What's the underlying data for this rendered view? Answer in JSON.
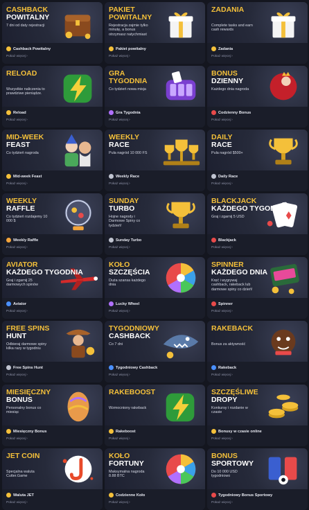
{
  "more_label": "Pokaż więcej",
  "more_chevron": "›",
  "cards": [
    {
      "title_yellow": "CASHBACK",
      "title_white": "POWITALNY",
      "title_single": "",
      "desc": "7 dni od daty rejestracji",
      "badge": "Cashback Powitalny",
      "badge_color": "#f4c03a",
      "art": "treasure-chest-icon"
    },
    {
      "title_yellow": "",
      "title_white": "",
      "title_single": "PAKIET\nPOWITALNY",
      "desc": "Rejestracja zajmie tylko minutę, a bonus otrzymasz natychmiast",
      "badge": "Pakiet powitalny",
      "badge_color": "#f4c03a",
      "art": "gift-box-icon"
    },
    {
      "title_yellow": "ZADANIA",
      "title_white": "",
      "title_single": "",
      "desc": "Complete tasks and earn cash rewards",
      "badge": "Zadania",
      "badge_color": "#f4c03a",
      "art": "gift-box-icon"
    },
    {
      "title_yellow": "RELOAD",
      "title_white": "",
      "title_single": "",
      "desc": "Wszystkie naliczenia to prawdziwe pieniądze.",
      "badge": "Reload",
      "badge_color": "#f4c03a",
      "art": "lightning-icon"
    },
    {
      "title_yellow": "",
      "title_white": "",
      "title_single": "GRA\nTYGODNIA",
      "desc": "Co tydzień nowa misja",
      "badge": "Gra Tygodnia",
      "badge_color": "#b070ff",
      "art": "slot-machine-icon"
    },
    {
      "title_yellow": "BONUS",
      "title_white": "DZIENNY",
      "title_single": "",
      "desc": "Każdego dnia nagroda",
      "badge": "Codzienny Bonus",
      "badge_color": "#e84a4a",
      "art": "queen-icon"
    },
    {
      "title_yellow": "MID-WEEK",
      "title_white": "FEAST",
      "title_single": "",
      "desc": "Co tydzień nagroda",
      "badge": "Mid-week Feast",
      "badge_color": "#f4c03a",
      "art": "characters-icon"
    },
    {
      "title_yellow": "WEEKLY",
      "title_white": "RACE",
      "title_single": "",
      "desc": "Pula nagród 10 000 FS",
      "badge": "Weekly Race",
      "badge_color": "#c0c4d0",
      "art": "trophies-icon"
    },
    {
      "title_yellow": "DAILY",
      "title_white": "RACE",
      "title_single": "",
      "desc": "Pula nagród $500+",
      "badge": "Daily Race",
      "badge_color": "#c0c4d0",
      "art": "trophy-icon"
    },
    {
      "title_yellow": "WEEKLY",
      "title_white": "RAFFLE",
      "title_single": "",
      "desc": "Co tydzień rozdajemy 10 000 $",
      "badge": "Weekly Raffle",
      "badge_color": "#f4a43a",
      "art": "lottery-ball-icon"
    },
    {
      "title_yellow": "SUNDAY",
      "title_white": "TURBO",
      "title_single": "",
      "desc": "Hojne nagrody i Darmowe Spiny co tydzień!",
      "badge": "Sunday Turbo",
      "badge_color": "#c0c4d0",
      "art": "trophy-icon"
    },
    {
      "title_yellow": "BLACKJACK",
      "title_white": "KAŻDEGO TYGODNIA",
      "title_single": "",
      "desc": "Graj i zgarnij 5 USD",
      "badge": "Blackjack",
      "badge_color": "#e84a4a",
      "art": "cards-icon"
    },
    {
      "title_yellow": "AVIATOR",
      "title_white": "KAŻDEGO TYGODNIA",
      "title_single": "",
      "desc": "Graj i zgarnij 25 darmowych spinów",
      "badge": "Aviator",
      "badge_color": "#4a90ff",
      "art": "plane-icon"
    },
    {
      "title_yellow": "KOŁO",
      "title_white": "SZCZĘŚCIA",
      "title_single": "",
      "desc": "Duża szansa każdego dnia",
      "badge": "Lucky Wheel",
      "badge_color": "#b070ff",
      "art": "wheel-icon"
    },
    {
      "title_yellow": "SPINNER",
      "title_white": "KAŻDEGO DNIA",
      "title_single": "",
      "desc": "Kręć i wygrywaj cashback, rakeback lub darmowe spiny co dzień!",
      "badge": "Spinner",
      "badge_color": "#e84a4a",
      "art": "spinner-icon"
    },
    {
      "title_yellow": "FREE SPINS",
      "title_white": "HUNT",
      "title_single": "",
      "desc": "Odbieraj darmowe spiny kilka razy w tygodniu",
      "badge": "Free Spins Hunt",
      "badge_color": "#c0c4d0",
      "art": "cowboy-icon"
    },
    {
      "title_yellow": "TYGODNIOWY",
      "title_white": "CASHBACK",
      "title_single": "",
      "desc": "Co 7 dni",
      "badge": "Tygodniowy Cashback",
      "badge_color": "#4a90ff",
      "art": "shark-icon"
    },
    {
      "title_yellow": "RAKEBACK",
      "title_white": "",
      "title_single": "",
      "desc": "Bonus za aktywność",
      "badge": "Rakeback",
      "badge_color": "#4a90ff",
      "art": "dog-icon"
    },
    {
      "title_yellow": "MIESIĘCZNY",
      "title_white": "BONUS",
      "title_single": "",
      "desc": "Personalny bonus co miesiąc",
      "badge": "Miesięczny Bonus",
      "badge_color": "#f4c03a",
      "art": "egg-icon"
    },
    {
      "title_yellow": "RAKEBOOST",
      "title_white": "",
      "title_single": "",
      "desc": "Wzmocniony rakeback",
      "badge": "Rakeboost",
      "badge_color": "#f4c03a",
      "art": "lightning-icon"
    },
    {
      "title_yellow": "SZCZĘŚLIWE",
      "title_white": "DROPY",
      "title_single": "",
      "desc": "Konkursy i rozdanie w czasie",
      "badge": "Bonusy w czasie online",
      "badge_color": "#f4c03a",
      "art": "coins-icon"
    },
    {
      "title_yellow": "JET COIN",
      "title_white": "",
      "title_single": "",
      "desc": "Specjalna waluta Cutter.Game",
      "badge": "Waluta JET",
      "badge_color": "#f4c03a",
      "art": "jet-coin-icon"
    },
    {
      "title_yellow": "KOŁO",
      "title_white": "FORTUNY",
      "title_single": "",
      "desc": "Maksymalna nagroda 8.88 BTC",
      "badge": "Codzienne Koło",
      "badge_color": "#f4c03a",
      "art": "wheel-icon"
    },
    {
      "title_yellow": "BONUS",
      "title_white": "SPORTOWY",
      "title_single": "",
      "desc": "Do 10 000 USD tygodniowo",
      "badge": "Tygodniowy Bonus Sportowy",
      "badge_color": "#e84a4a",
      "art": "sport-icon"
    }
  ]
}
